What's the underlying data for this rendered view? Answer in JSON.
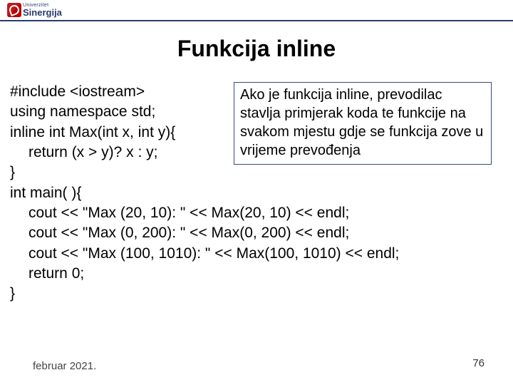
{
  "logo": {
    "univerzitet": "Univerzitet",
    "name": "Sinergija"
  },
  "title": "Funkcija inline",
  "code": {
    "l1": "#include <iostream>",
    "l2": "using namespace std;",
    "l3": "inline int Max(int x, int y){",
    "l4": "return (x > y)? x : y;",
    "l5": "}",
    "l6": "int main( ){",
    "l7": "cout << \"Max (20, 10): \" << Max(20, 10) << endl;",
    "l8": "cout << \"Max (0, 200): \" << Max(0, 200) << endl;",
    "l9": "cout << \"Max (100, 1010): \" << Max(100, 1010) << endl;",
    "l10": "return 0;",
    "l11": "}"
  },
  "callout": "Ako je funkcija inline, prevodilac stavlja primjerak koda te funkcije na svakom mjestu gdje se funkcija zove u vrijeme prevođenja",
  "footer": {
    "date": "februar 2021.",
    "page": "76"
  }
}
